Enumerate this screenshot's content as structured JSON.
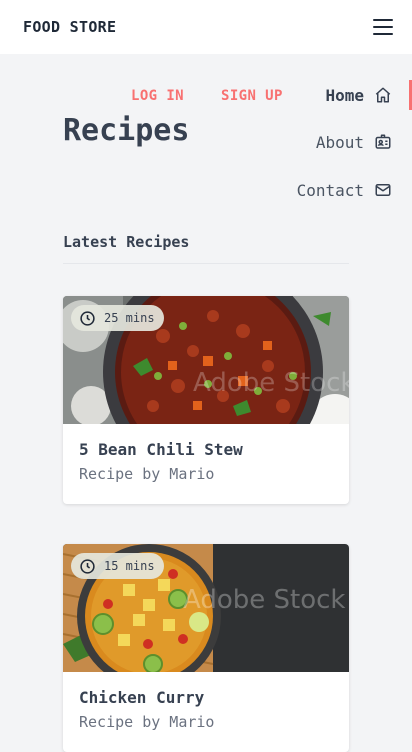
{
  "header": {
    "brand": "FOOD STORE"
  },
  "auth": {
    "login": "LOG IN",
    "signup": "SIGN UP"
  },
  "page": {
    "title": "Recipes",
    "section_title": "Latest Recipes"
  },
  "nav": [
    {
      "label": "Home",
      "icon": "home-icon"
    },
    {
      "label": "About",
      "icon": "id-card-icon"
    },
    {
      "label": "Contact",
      "icon": "mail-icon"
    }
  ],
  "recipes": [
    {
      "time": "25 mins",
      "name": "5 Bean Chili Stew",
      "author": "Recipe by Mario"
    },
    {
      "time": "15 mins",
      "name": "Chicken Curry",
      "author": "Recipe by Mario"
    }
  ],
  "colors": {
    "accent": "#f87171",
    "text": "#374151",
    "background": "#f3f4f6"
  }
}
